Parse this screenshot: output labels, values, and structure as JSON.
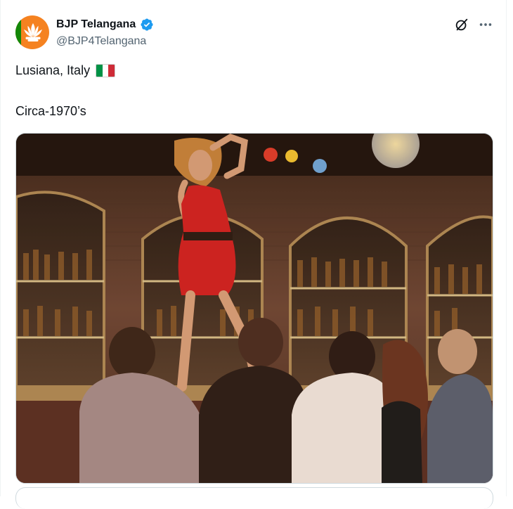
{
  "author": {
    "name": "BJP Telangana",
    "handle": "@BJP4Telangana",
    "verified": true,
    "avatar_icon": "lotus-logo-icon"
  },
  "actions": {
    "grok_icon": "grok-icon",
    "more_icon": "more-options-icon"
  },
  "tweet": {
    "line1": "Lusiana, Italy",
    "flag": "italy-flag-icon",
    "line2": "Circa-1970’s"
  },
  "media": {
    "type": "photo"
  },
  "colors": {
    "verified_blue": "#1d9bf0",
    "text_primary": "#0f1419",
    "text_secondary": "#536471",
    "avatar_orange": "#f58220",
    "avatar_green": "#138808"
  }
}
